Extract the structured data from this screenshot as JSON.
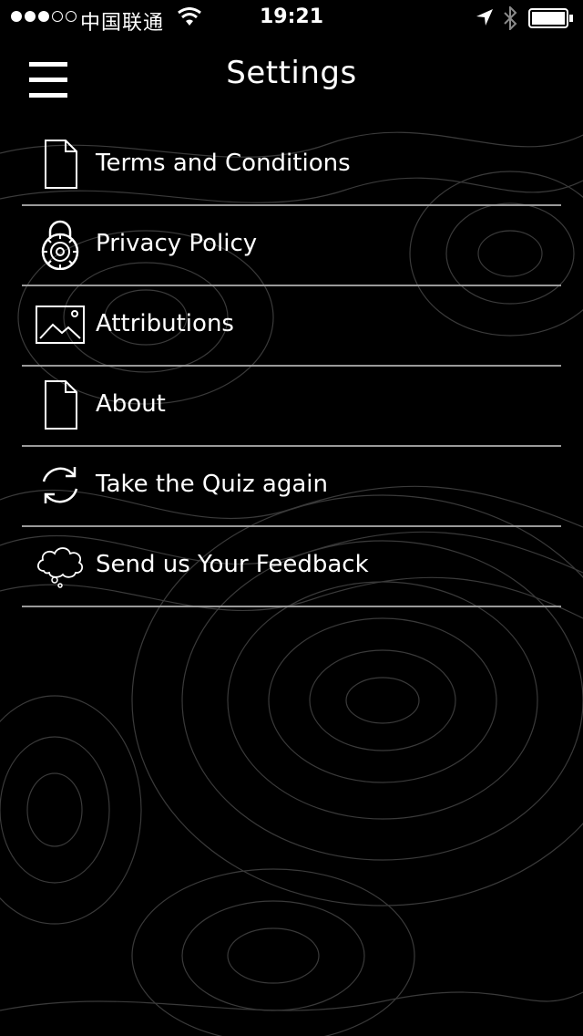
{
  "status_bar": {
    "carrier": "中国联通",
    "time": "19:21",
    "signal_icon": "signal-dots-icon",
    "wifi_icon": "wifi-icon",
    "location_icon": "location-arrow-icon",
    "bluetooth_icon": "bluetooth-icon",
    "battery_icon": "battery-icon",
    "battery_level": 1.0
  },
  "nav": {
    "title": "Settings",
    "menu_icon": "hamburger-menu-icon"
  },
  "menu": {
    "items": [
      {
        "label": "Terms and Conditions",
        "icon": "document-icon"
      },
      {
        "label": "Privacy Policy",
        "icon": "padlock-icon"
      },
      {
        "label": "Attributions",
        "icon": "image-icon"
      },
      {
        "label": "About",
        "icon": "document-icon"
      },
      {
        "label": "Take the Quiz again",
        "icon": "refresh-icon"
      },
      {
        "label": "Send us Your Feedback",
        "icon": "thought-cloud-icon"
      }
    ]
  },
  "colors": {
    "background": "#000000",
    "text": "#ffffff",
    "divider": "#9a9a9a",
    "topo_lines": "#3a3a3a"
  }
}
